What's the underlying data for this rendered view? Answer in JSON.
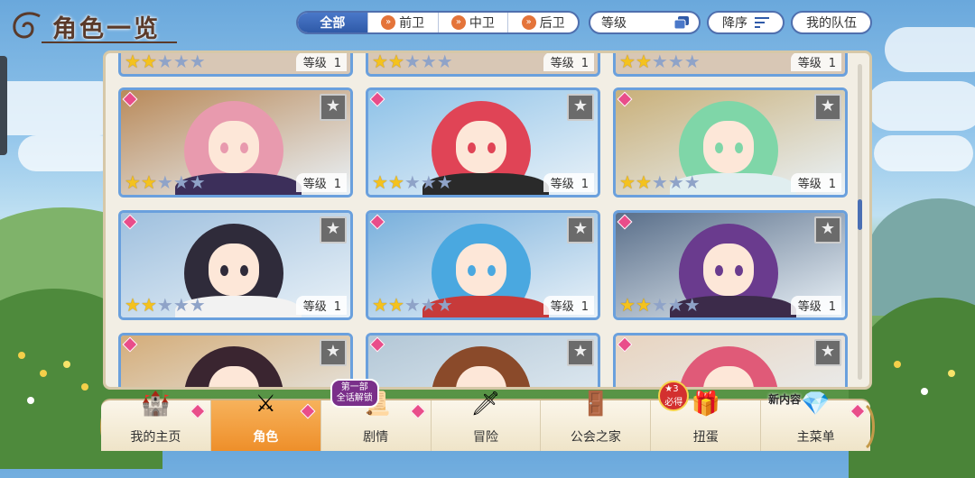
{
  "header": {
    "title": "角色一览",
    "filters": [
      {
        "label": "全部",
        "active": true,
        "icon": ""
      },
      {
        "label": "前卫",
        "active": false,
        "icon": "chevron-icon"
      },
      {
        "label": "中卫",
        "active": false,
        "icon": "chevron-icon"
      },
      {
        "label": "后卫",
        "active": false,
        "icon": "chevron-icon"
      }
    ],
    "sort_label": "等级",
    "order_label": "降序",
    "team_label": "我的队伍"
  },
  "grid": {
    "level_prefix": "等级",
    "top_partial_row": [
      {
        "stars": 2,
        "level": "1"
      },
      {
        "stars": 2,
        "level": "1"
      },
      {
        "stars": 2,
        "level": "1"
      }
    ],
    "cards": [
      {
        "stars": 2,
        "level": "1",
        "hair": "#e89aae",
        "bg": "#b98a5a",
        "outfit": "#3c2f5a"
      },
      {
        "stars": 2,
        "level": "1",
        "hair": "#e04456",
        "bg": "#8ec2e8",
        "outfit": "#2a2a2a"
      },
      {
        "stars": 2,
        "level": "1",
        "hair": "#7fd6a8",
        "bg": "#c9b07a",
        "outfit": "#e0eef0"
      },
      {
        "stars": 2,
        "level": "1",
        "hair": "#2f2b3a",
        "bg": "#9fc0de",
        "outfit": "#f2f2f2"
      },
      {
        "stars": 2,
        "level": "1",
        "hair": "#4aa8e0",
        "bg": "#79b0dc",
        "outfit": "#c73a3a"
      },
      {
        "stars": 2,
        "level": "1",
        "hair": "#6a3b8e",
        "bg": "#5a6f8a",
        "outfit": "#3c2b4a"
      },
      {
        "stars": 0,
        "level": "",
        "hair": "#3a2530",
        "bg": "#d4ad7a",
        "outfit": "#f0f0f0"
      },
      {
        "stars": 0,
        "level": "",
        "hair": "#8a4a2a",
        "bg": "#b3c7d6",
        "outfit": "#5a3a2a"
      },
      {
        "stars": 0,
        "level": "",
        "hair": "#e05a78",
        "bg": "#e8d4c0",
        "outfit": "#c0392b"
      }
    ],
    "max_stars": 5
  },
  "nav": {
    "items": [
      {
        "label": "我的主页",
        "icon": "castle-icon",
        "glyph": "🏰",
        "active": false
      },
      {
        "label": "角色",
        "icon": "character-icon",
        "glyph": "⚔",
        "active": true
      },
      {
        "label": "剧情",
        "icon": "scroll-icon",
        "glyph": "📜",
        "active": false,
        "badge": "第一部\n全话解锁"
      },
      {
        "label": "冒险",
        "icon": "sword-icon",
        "glyph": "🗡",
        "active": false
      },
      {
        "label": "公会之家",
        "icon": "door-icon",
        "glyph": "🚪",
        "active": false
      },
      {
        "label": "扭蛋",
        "icon": "gacha-icon",
        "glyph": "🎁",
        "active": false,
        "badge": "★3\n必得"
      },
      {
        "label": "主菜单",
        "icon": "crystal-icon",
        "glyph": "💎",
        "active": false,
        "badge": "新内容"
      }
    ]
  },
  "colors": {
    "accent": "#2f5aa8",
    "star": "#f4c21e",
    "gem": "#e94d8a",
    "active_tab": "#ee8f2a"
  }
}
